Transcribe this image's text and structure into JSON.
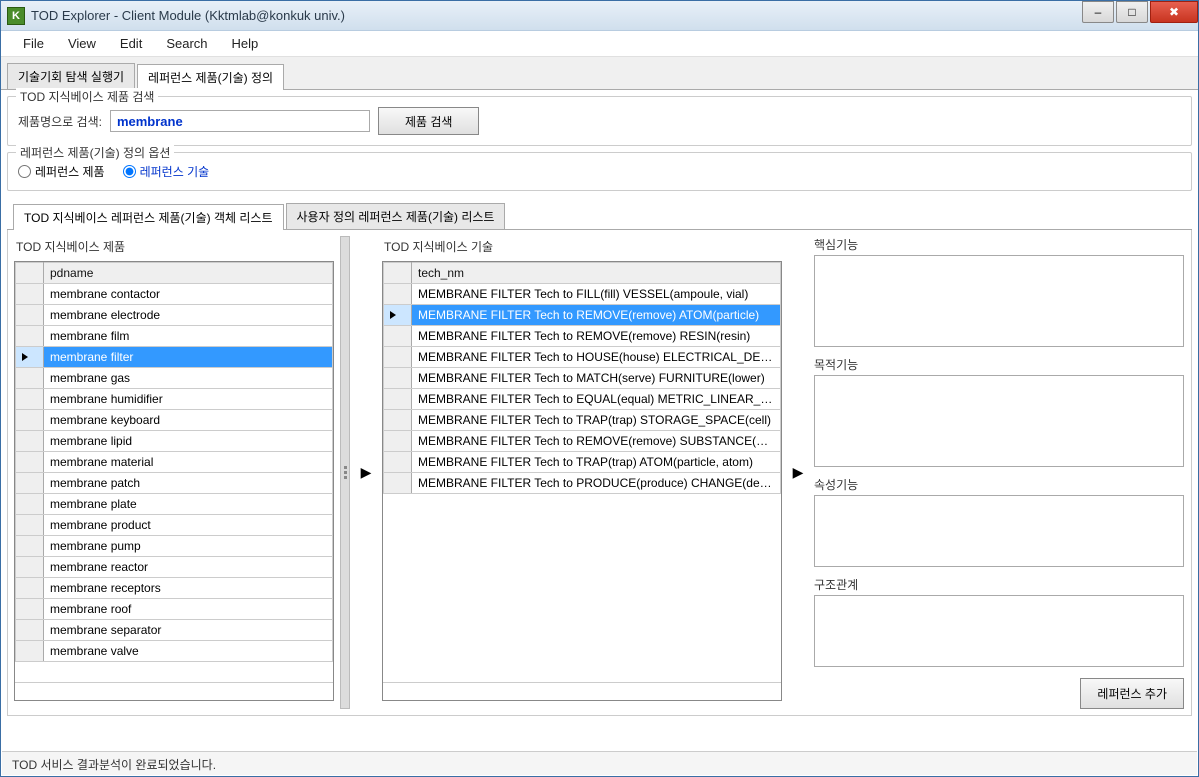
{
  "window": {
    "title": "TOD Explorer - Client Module (Kktmlab@konkuk univ.)",
    "icon_letter": "K"
  },
  "menu": {
    "file": "File",
    "view": "View",
    "edit": "Edit",
    "search": "Search",
    "help": "Help"
  },
  "main_tabs": {
    "tab1": "기술기회 탐색 실행기",
    "tab2": "레퍼런스 제품(기술) 정의"
  },
  "search_group": {
    "legend": "TOD 지식베이스 제품 검색",
    "label": "제품명으로 검색:",
    "value": "membrane",
    "button": "제품 검색"
  },
  "option_group": {
    "legend": "레퍼런스 제품(기술) 정의 옵션",
    "opt1": "레퍼런스 제품",
    "opt2": "레퍼런스 기술"
  },
  "inner_tabs": {
    "tab1": "TOD 지식베이스 레퍼런스 제품(기술) 객체 리스트",
    "tab2": "사용자 정의 레퍼런스 제품(기술) 리스트"
  },
  "product_list": {
    "title": "TOD 지식베이스 제품",
    "header": "pdname",
    "items": [
      "membrane contactor",
      "membrane electrode",
      "membrane film",
      "membrane filter",
      "membrane gas",
      "membrane humidifier",
      "membrane keyboard",
      "membrane lipid",
      "membrane material",
      "membrane patch",
      "membrane plate",
      "membrane product",
      "membrane pump",
      "membrane reactor",
      "membrane receptors",
      "membrane roof",
      "membrane separator",
      "membrane valve"
    ],
    "selected_index": 3
  },
  "tech_list": {
    "title": "TOD 지식베이스 기술",
    "header": "tech_nm",
    "items": [
      "MEMBRANE FILTER Tech to FILL(fill) VESSEL(ampoule, vial)",
      "MEMBRANE FILTER Tech to REMOVE(remove) ATOM(particle)",
      "MEMBRANE FILTER Tech to REMOVE(remove) RESIN(resin)",
      "MEMBRANE FILTER Tech to HOUSE(house) ELECTRICAL_DEVICE(",
      "MEMBRANE FILTER Tech to MATCH(serve) FURNITURE(lower)",
      "MEMBRANE FILTER Tech to EQUAL(equal) METRIC_LINEAR_UNIT(",
      "MEMBRANE FILTER Tech to TRAP(trap) STORAGE_SPACE(cell)",
      "MEMBRANE FILTER Tech to REMOVE(remove) SUBSTANCE(subst",
      "MEMBRANE FILTER Tech to TRAP(trap) ATOM(particle, atom)",
      "MEMBRANE FILTER Tech to PRODUCE(produce) CHANGE(deliver"
    ],
    "selected_index": 1
  },
  "right": {
    "core": "핵심기능",
    "purpose": "목적기능",
    "attribute": "속성기능",
    "structure": "구조관계",
    "add_button": "레퍼런스 추가"
  },
  "status": "TOD 서비스 결과분석이 완료되었습니다."
}
